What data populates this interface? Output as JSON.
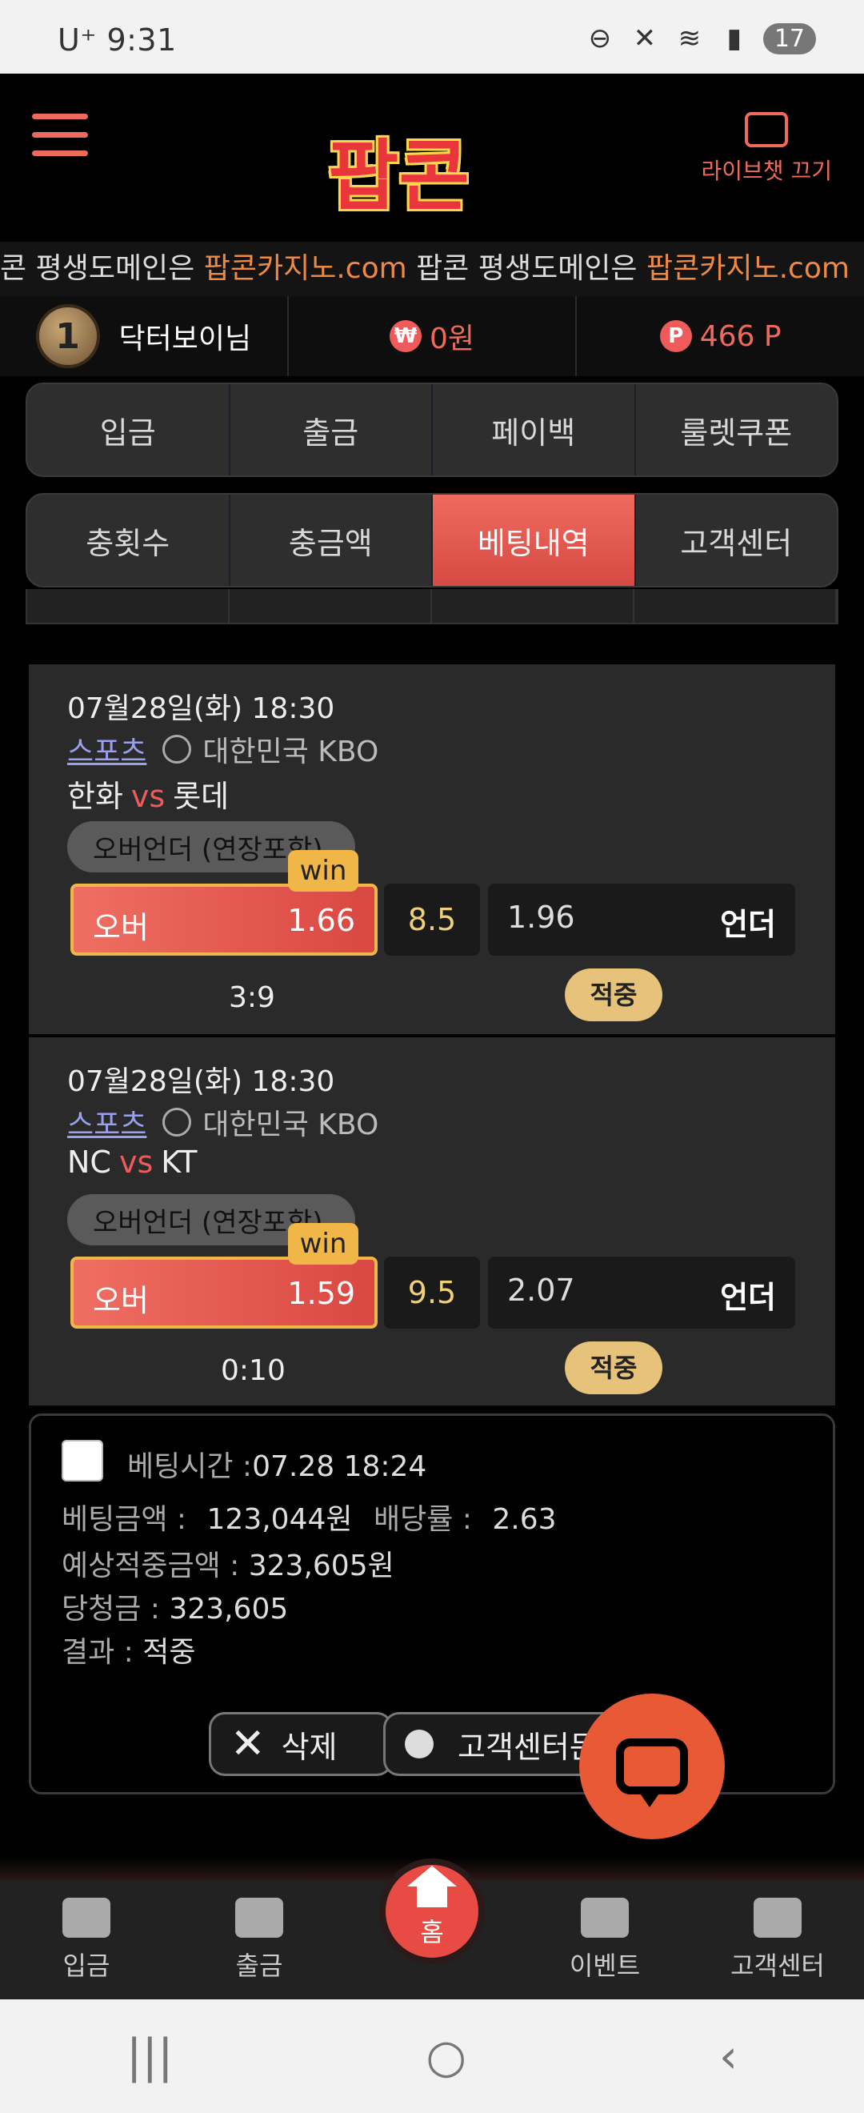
{
  "status_bar": {
    "carrier": "U⁺ 9:31",
    "icons_right": [
      "dnd-icon",
      "mute-icon",
      "wifi-icon",
      "signal-icon"
    ],
    "battery": "17"
  },
  "header": {
    "logo": "팝콘",
    "livechat_label": "라이브챗 끄기"
  },
  "ticker": [
    {
      "t": "콘 ",
      "c": "w"
    },
    {
      "t": "평생도메인은 ",
      "c": "w"
    },
    {
      "t": "팝콘카지노.com",
      "c": "o"
    },
    {
      "t": " 팝콘 ",
      "c": "w"
    },
    {
      "t": "평생도메인은 ",
      "c": "w"
    },
    {
      "t": "팝콘카지노.com",
      "c": "o"
    }
  ],
  "user": {
    "level": "1",
    "name": "닥터보이님",
    "money": "0원",
    "money_symbol": "₩",
    "point_symbol": "P",
    "points": "466 P"
  },
  "tabs_row1": [
    "입금",
    "출금",
    "페이백",
    "룰렛쿠폰"
  ],
  "tabs_row2": [
    "충횟수",
    "충금액",
    "베팅내역",
    "고객센터"
  ],
  "bets": [
    {
      "date": "07월28일(화) 18:30",
      "sport": "스포츠",
      "country": "대한민국 KBO",
      "home": "한화",
      "vs": "vs",
      "away": "롯데",
      "market": "오버언더 (연장포함)",
      "over_label": "오버",
      "over_odds": "1.66",
      "line": "8.5",
      "under_odds": "1.96",
      "under_label": "언더",
      "win_badge": "win",
      "score": "3:9",
      "result": "적중"
    },
    {
      "date": "07월28일(화) 18:30",
      "sport": "스포츠",
      "country": "대한민국 KBO",
      "home": "NC",
      "vs": "vs",
      "away": "KT",
      "market": "오버언더 (연장포함)",
      "over_label": "오버",
      "over_odds": "1.59",
      "line": "9.5",
      "under_odds": "2.07",
      "under_label": "언더",
      "win_badge": "win",
      "score": "0:10",
      "result": "적중"
    }
  ],
  "summary": {
    "bet_time_label": "베팅시간 :",
    "bet_time": "07.28 18:24",
    "bet_amount_label": "베팅금액 :",
    "bet_amount": "123,044원",
    "odds_label": "배당률 :",
    "odds": "2.63",
    "expected_label": "예상적중금액 :",
    "expected": "323,605원",
    "winnings_label": "당청금 :",
    "winnings": "323,605",
    "result_label": "결과 :",
    "result": "적중",
    "delete_label": "삭제",
    "support_label": "고객센터문"
  },
  "bottom_nav": {
    "deposit": "입금",
    "withdraw": "출금",
    "home": "홈",
    "event": "이벤트",
    "support": "고객센터"
  },
  "system_nav": {
    "recents": "|||",
    "home": "○",
    "back": "‹"
  }
}
